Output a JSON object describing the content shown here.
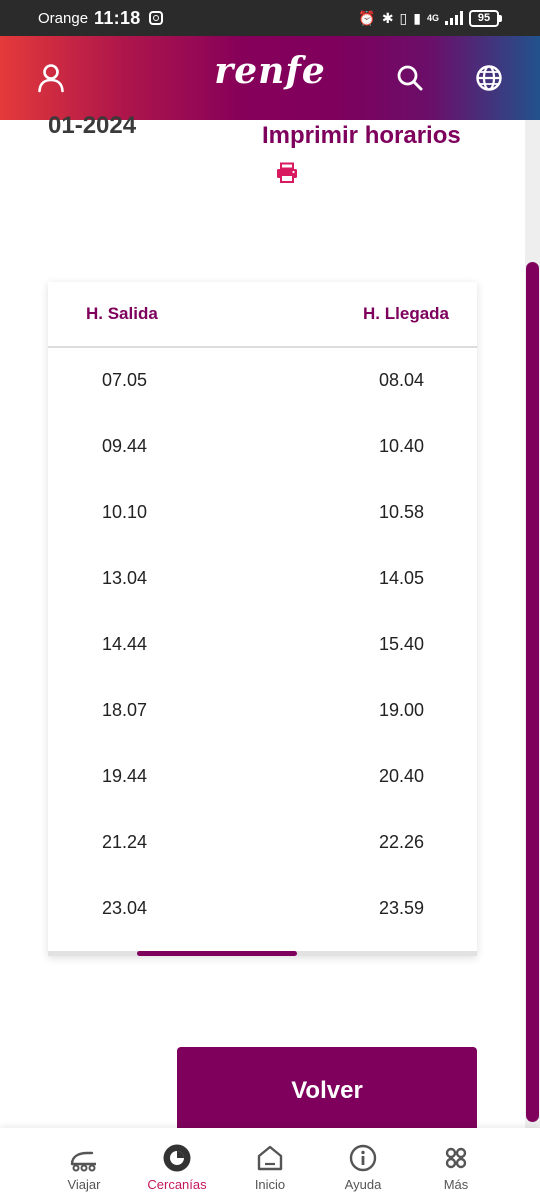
{
  "status_bar": {
    "carrier": "Orange",
    "time": "11:18",
    "network": "4G",
    "battery": "95"
  },
  "header": {
    "logo": "renfe",
    "icons": [
      "user-icon",
      "search-icon",
      "globe-icon"
    ]
  },
  "content": {
    "date_fragment": "01-2024",
    "print_label": "Imprimir horarios"
  },
  "timetable": {
    "columns": [
      "H. Salida",
      "H. Llegada"
    ],
    "rows": [
      [
        "07.05",
        "08.04"
      ],
      [
        "09.44",
        "10.40"
      ],
      [
        "10.10",
        "10.58"
      ],
      [
        "13.04",
        "14.05"
      ],
      [
        "14.44",
        "15.40"
      ],
      [
        "18.07",
        "19.00"
      ],
      [
        "19.44",
        "20.40"
      ],
      [
        "21.24",
        "22.26"
      ],
      [
        "23.04",
        "23.59"
      ]
    ]
  },
  "actions": {
    "back_label": "Volver"
  },
  "bottom_nav": {
    "items": [
      {
        "label": "Viajar",
        "icon": "train-icon"
      },
      {
        "label": "Cercanías",
        "icon": "cercanias-icon",
        "active": true
      },
      {
        "label": "Inicio",
        "icon": "home-icon"
      },
      {
        "label": "Ayuda",
        "icon": "info-icon"
      },
      {
        "label": "Más",
        "icon": "more-icon"
      }
    ]
  },
  "colors": {
    "brand": "#7e005c",
    "active_nav": "#c2185b",
    "status_bar": "#2b2b2b"
  }
}
